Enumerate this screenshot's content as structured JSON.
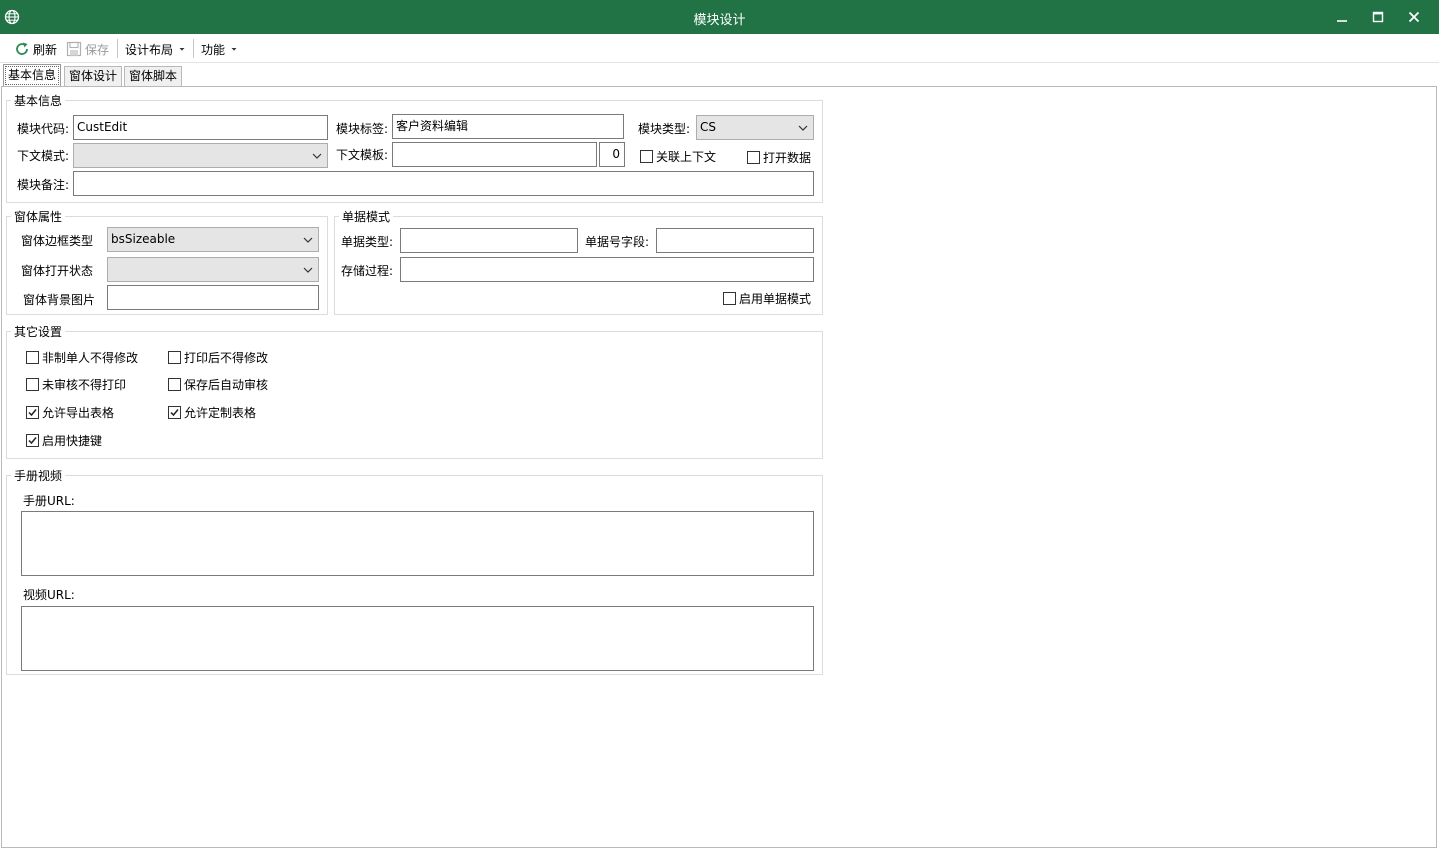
{
  "window": {
    "title": "模块设计",
    "minimize_glyph": "—",
    "maximize_glyph": "□",
    "close_glyph": "✕"
  },
  "toolbar": {
    "refresh_label": "刷新",
    "save_label": "保存",
    "layout_label": "设计布局",
    "function_label": "功能"
  },
  "tabs": [
    "基本信息",
    "窗体设计",
    "窗体脚本"
  ],
  "basic_info": {
    "title": "基本信息",
    "module_code_label": "模块代码:",
    "module_code_value": "CustEdit",
    "module_tag_label": "模块标签:",
    "module_tag_value": "客户资料编辑",
    "module_type_label": "模块类型:",
    "module_type_value": "CS",
    "context_mode_label": "下文模式:",
    "context_mode_value": "",
    "context_template_label": "下文模板:",
    "context_template_value": "",
    "context_template_num": "0",
    "link_context_label": "关联上下文",
    "open_data_label": "打开数据",
    "remark_label": "模块备注:",
    "remark_value": ""
  },
  "form_props": {
    "title": "窗体属性",
    "border_label": "窗体边框类型",
    "border_value": "bsSizeable",
    "open_state_label": "窗体打开状态",
    "open_state_value": "",
    "bg_image_label": "窗体背景图片",
    "bg_image_value": ""
  },
  "doc_mode": {
    "title": "单据模式",
    "doc_type_label": "单据类型:",
    "doc_type_value": "",
    "doc_no_label": "单据号字段:",
    "doc_no_value": "",
    "proc_label": "存储过程:",
    "proc_value": "",
    "enable_label": "启用单据模式"
  },
  "other": {
    "title": "其它设置",
    "opt1": "非制单人不得修改",
    "opt2": "打印后不得修改",
    "opt3": "未审核不得打印",
    "opt4": "保存后自动审核",
    "opt5": "允许导出表格",
    "opt6": "允许定制表格",
    "opt7": "启用快捷键"
  },
  "manual": {
    "title": "手册视频",
    "manual_url_label": "手册URL:",
    "video_url_label": "视频URL:"
  },
  "colors": {
    "titlebar": "#217346",
    "refresh_icon": "#2e8b57"
  }
}
